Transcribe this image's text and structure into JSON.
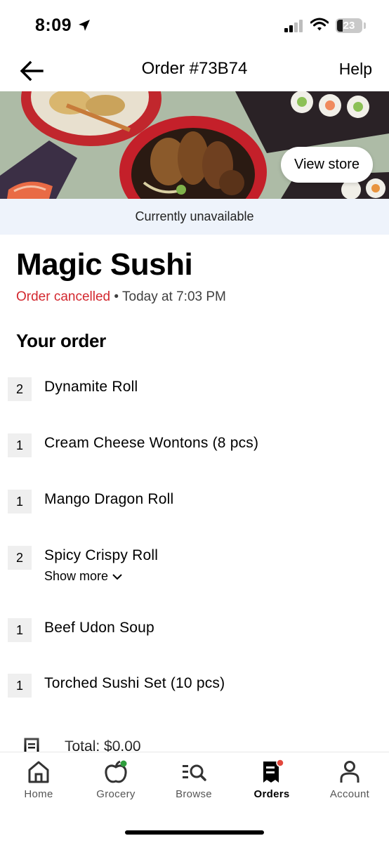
{
  "status_bar": {
    "time": "8:09",
    "battery": "23"
  },
  "header": {
    "title": "Order #73B74",
    "help_label": "Help"
  },
  "hero": {
    "view_store_label": "View store"
  },
  "banner": {
    "text": "Currently unavailable"
  },
  "store": {
    "name": "Magic Sushi",
    "status": "Order cancelled",
    "separator": " • ",
    "time": "Today at 7:03 PM"
  },
  "order": {
    "section_title": "Your order",
    "items": [
      {
        "qty": "2",
        "name": "Dynamite Roll"
      },
      {
        "qty": "1",
        "name": "Cream Cheese Wontons (8 pcs)"
      },
      {
        "qty": "1",
        "name": "Mango Dragon Roll"
      },
      {
        "qty": "2",
        "name": "Spicy Crispy Roll",
        "show_more": "Show more"
      },
      {
        "qty": "1",
        "name": "Beef Udon Soup"
      },
      {
        "qty": "1",
        "name": "Torched Sushi Set (10 pcs)"
      }
    ],
    "total": "Total: $0.00"
  },
  "tabs": [
    {
      "label": "Home",
      "icon": "home-icon"
    },
    {
      "label": "Grocery",
      "icon": "apple-icon"
    },
    {
      "label": "Browse",
      "icon": "browse-search-icon"
    },
    {
      "label": "Orders",
      "icon": "receipt-icon",
      "active": true
    },
    {
      "label": "Account",
      "icon": "person-icon"
    }
  ],
  "colors": {
    "cancelled": "#d3282f",
    "banner_bg": "#eef3fb",
    "badge_bg": "#efefef",
    "notification_dot_green": "#2e9e3c",
    "notification_dot_red": "#e2483d"
  }
}
